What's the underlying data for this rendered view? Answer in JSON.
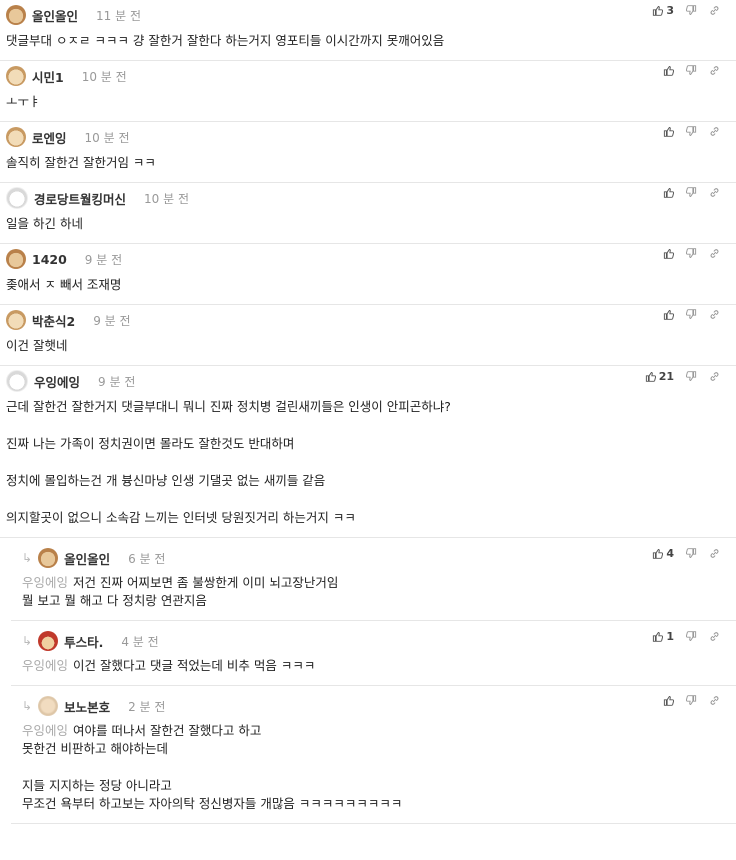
{
  "comments": [
    {
      "author": "올인올인",
      "time": "11 분 전",
      "likes": "3",
      "avatar": "dog",
      "lines": [
        "댓글부대 ㅇㅈㄹ ㅋㅋㅋ 걍 잘한거 잘한다 하는거지 영포티들 이시간까지 못깨어있음"
      ]
    },
    {
      "author": "시민1",
      "time": "10 분 전",
      "likes": "",
      "avatar": "dog2",
      "lines": [
        "ㅗㅜㅑ"
      ]
    },
    {
      "author": "로엔잉",
      "time": "10 분 전",
      "likes": "",
      "avatar": "dog2",
      "lines": [
        "솔직히 잘한건 잘한거임 ㅋㅋ"
      ]
    },
    {
      "author": "경로당트월킹머신",
      "time": "10 분 전",
      "likes": "",
      "avatar": "white",
      "lines": [
        "일을 하긴 하네"
      ]
    },
    {
      "author": "1420",
      "time": "9 분 전",
      "likes": "",
      "avatar": "dog",
      "lines": [
        "좆애서 ㅈ 빼서 조재명"
      ]
    },
    {
      "author": "박춘식2",
      "time": "9 분 전",
      "likes": "",
      "avatar": "dog2",
      "lines": [
        "이건 잘햇네"
      ]
    },
    {
      "author": "우잉에잉",
      "time": "9 분 전",
      "likes": "21",
      "avatar": "white",
      "lines": [
        "근데 잘한건 잘한거지 댓글부대니 뭐니 진짜 정치병 걸린새끼들은 인생이 안피곤하냐?",
        "",
        "진짜 나는 가족이 정치권이면 몰라도 잘한것도 반대하며",
        "",
        "정치에 몰입하는건 개 븅신마냥 인생 기댈곳 없는 새끼들 같음",
        "",
        "의지할곳이 없으니 소속감 느끼는 인터넷 당원짓거리 하는거지 ㅋㅋ"
      ]
    }
  ],
  "replies": [
    {
      "author": "올인올인",
      "time": "6 분 전",
      "likes": "4",
      "avatar": "dog",
      "mention": "우잉에잉",
      "lines": [
        "저건 진짜 어찌보면 좀 불쌍한게 이미 뇌고장난거임",
        "뭘 보고 뭘 해고 다 정치랑 연관지음"
      ]
    },
    {
      "author": "투스타.",
      "time": "4 분 전",
      "likes": "1",
      "avatar": "red",
      "mention": "우잉에잉",
      "lines": [
        "이건 잘했다고 댓글 적었는데 비추 먹음 ㅋㅋㅋ"
      ]
    },
    {
      "author": "보노본호",
      "time": "2 분 전",
      "likes": "",
      "avatar": "blur",
      "mention": "우잉에잉",
      "lines": [
        "여야를 떠나서 잘한건 잘했다고 하고",
        "못한건 비판하고 해야하는데",
        "",
        "지들 지지하는 정당 아니라고",
        "무조건 욕부터 하고보는 자아의탁 정신병자들 개많음 ㅋㅋㅋㅋㅋㅋㅋㅋㅋ"
      ]
    }
  ],
  "icons": {
    "like": "thumbs-up-icon",
    "dislike": "thumbs-down-icon",
    "link": "link-icon",
    "reply": "reply-arrow-icon"
  }
}
